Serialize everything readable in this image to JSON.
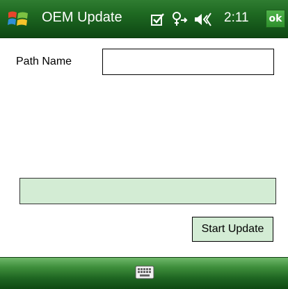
{
  "titlebar": {
    "title": "OEM Update",
    "clock": "2:11",
    "ok_label": "ok"
  },
  "form": {
    "path_label": "Path Name",
    "path_value": "",
    "progress_fraction": 0,
    "start_update_label": "Start Update"
  },
  "icons": {
    "start": "windows-flag-icon",
    "status": [
      "task-checkbox-icon",
      "connectivity-icon",
      "volume-icon"
    ],
    "keyboard": "keyboard-icon"
  },
  "colors": {
    "titlebar": "#1f6a22",
    "control_fill": "#d3ecd4",
    "ok_button": "#2e8f2c"
  }
}
